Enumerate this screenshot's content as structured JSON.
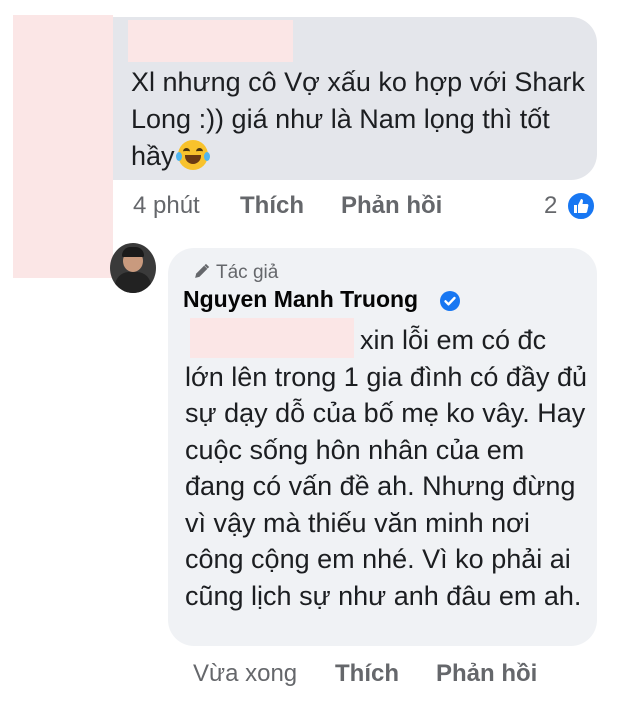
{
  "comment1": {
    "text": "Xl nhưng cô Vợ xấu ko hợp với Shark Long  :)) giá như là Nam lọng thì tốt hầy",
    "emoji": "laughing-tears-emoji",
    "time": "4 phút",
    "like_label": "Thích",
    "reply_label": "Phản hồi",
    "reaction_count": "2",
    "reaction_icon": "like-icon"
  },
  "reply": {
    "badge": "Tác giả",
    "author": "Nguyen Manh Truong",
    "verified_icon": "verified-badge-icon",
    "text": "xin lỗi em có đc lớn lên trong 1 gia đình có đầy đủ sự dạy dỗ của bố mẹ ko vây. Hay cuộc sống hôn nhân của em đang có vấn đề ah. Nhưng đừng vì vậy mà thiếu văn minh nơi công cộng em nhé. Vì ko phải ai cũng lịch sự như anh đâu em ah.",
    "time": "Vừa xong",
    "like_label": "Thích",
    "reply_label": "Phản hồi"
  },
  "colors": {
    "bubble_primary": "#e4e6eb",
    "bubble_reply": "#f0f2f5",
    "meta_text": "#65676b",
    "facebook_blue": "#1877f2",
    "redaction": "#fbe6e6"
  }
}
